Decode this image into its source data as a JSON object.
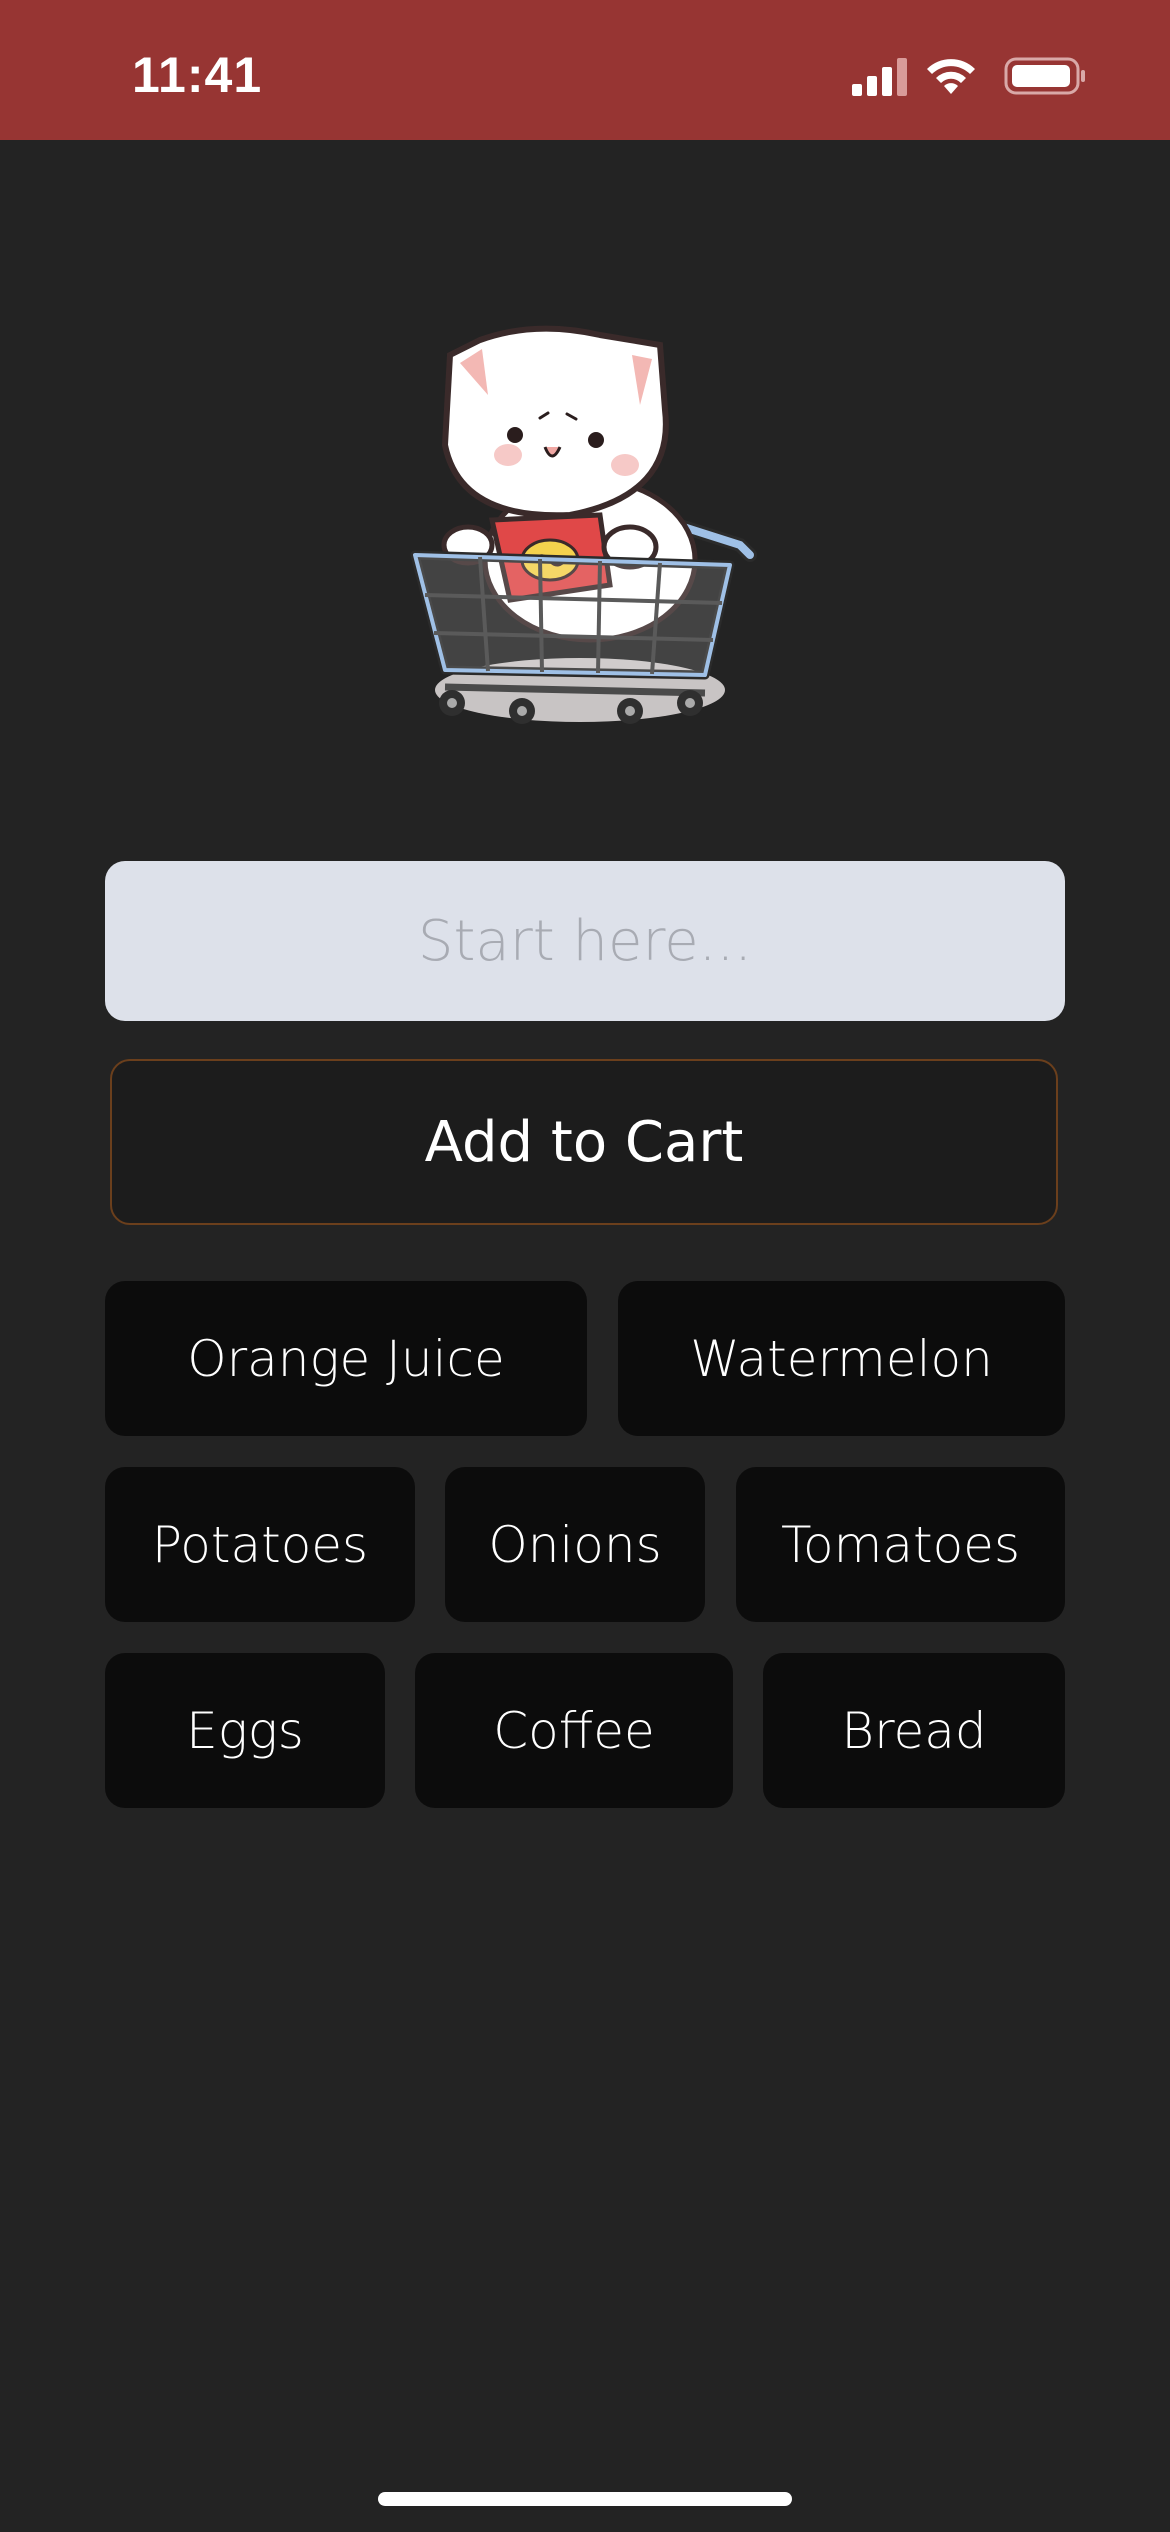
{
  "status_bar": {
    "time": "11:41",
    "background_color": "#973533",
    "signal_icon": "cellular-signal-icon",
    "wifi_icon": "wifi-icon",
    "battery_icon": "battery-icon"
  },
  "illustration": {
    "icon": "cat-in-shopping-cart-illustration"
  },
  "search": {
    "placeholder": "Start here...",
    "value": ""
  },
  "add_button": {
    "label": "Add to Cart",
    "border_color": "#6b3f1c"
  },
  "suggestions": [
    {
      "label": "Orange Juice"
    },
    {
      "label": "Watermelon"
    },
    {
      "label": "Potatoes"
    },
    {
      "label": "Onions"
    },
    {
      "label": "Tomatoes"
    },
    {
      "label": "Eggs"
    },
    {
      "label": "Coffee"
    },
    {
      "label": "Bread"
    }
  ]
}
